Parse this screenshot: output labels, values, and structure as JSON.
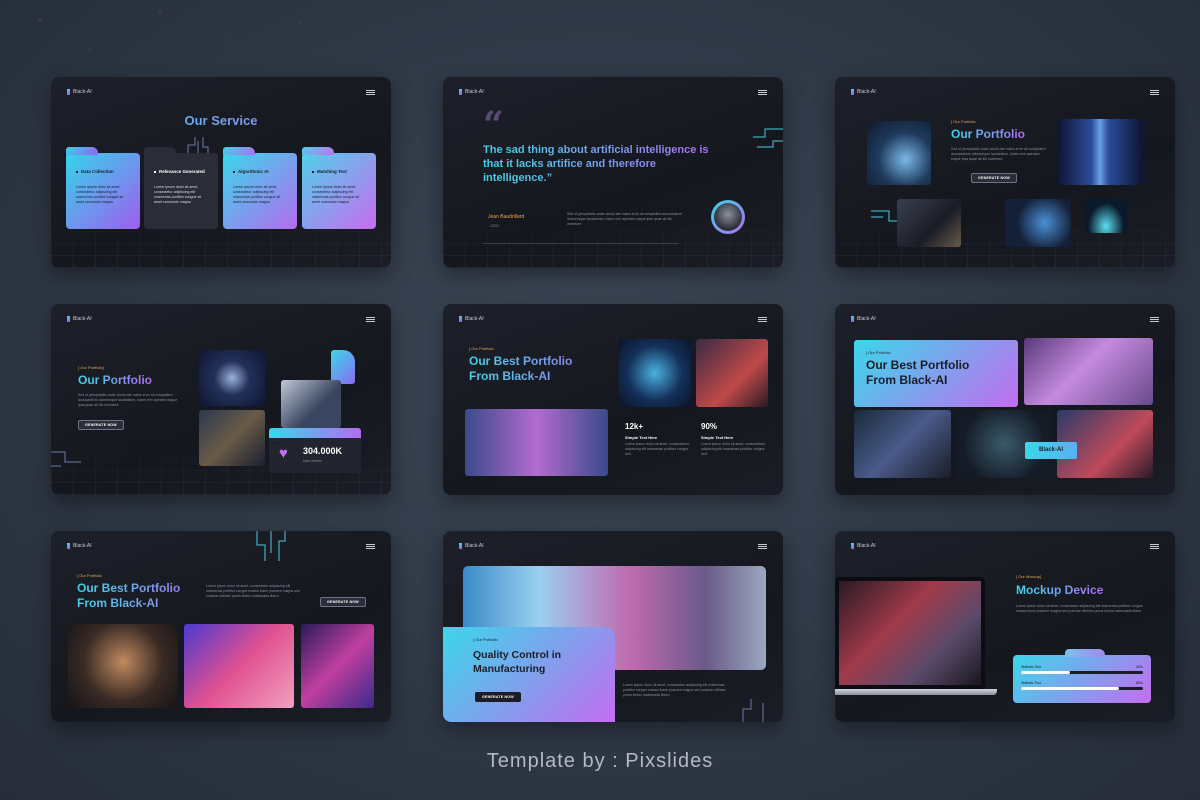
{
  "brand": "Black-AI",
  "footer": "Template by : Pixslides",
  "slide1": {
    "title": "Our Service",
    "cards": [
      {
        "title": "Data Collection",
        "text": "Lorem ipsum dolor sit amet, consectetur adipiscing elit maecenas porttitor congue sit amet commodo magna"
      },
      {
        "title": "Relevance Generated",
        "text": "Lorem ipsum dolor sit amet, consectetur adipiscing elit maecenas porttitor congue sit amet commodo magna"
      },
      {
        "title": "Algorithmic AI",
        "text": "Lorem ipsum dolor sit amet, consectetur adipiscing elit maecenas porttitor congue sit amet commodo magna"
      },
      {
        "title": "Matching Text",
        "text": "Lorem ipsum dolor sit amet, consectetur adipiscing elit maecenas porttitor congue sit amet commodo magna"
      }
    ]
  },
  "slide2": {
    "quote_mark": "“",
    "quote": "The sad thing about artificial intelligence is that it lacks artifice and therefore intelligence.”",
    "author": "Jean Baudrillard",
    "role": "- CEO",
    "text": "Sed ut perspiciatis unde omnis iste natus error sit voluptatem accusantium doloremque laudantium, totam rem aperiam eaque ipsa quae ab illo inventore"
  },
  "slide3": {
    "tag": "[ Our Portfolio",
    "title": "Our Portfolio",
    "text": "Sed ut perspiciatis unde omnis iste natus error sit voluptatem accusantium doloremque laudantium, totam rem aperiam eaque ipsa quae ab illo inventore.",
    "button": "GENERATE NOW"
  },
  "slide4": {
    "tag": "[ Our Portfolio]",
    "title": "Our Portfolio",
    "text": "Sed ut perspiciatis unde omnis iste natus error sit voluptatem accusantium doloremque laudantium, totam rem aperiam eaque ipsa quae ab illo inventore",
    "button": "GENERATE NOW",
    "stat_value": "304.000K",
    "stat_label": "User review"
  },
  "slide5": {
    "tag": "[ Our Portfolio",
    "title_line1": "Our Best Portfolio",
    "title_line2": "From Black-AI",
    "stats": [
      {
        "value": "12k+",
        "label": "Simple Text Here",
        "text": "Lorem ipsum dolor sit amet, consectetuer adipiscing elit maecenas porttitor congue sed"
      },
      {
        "value": "90%",
        "label": "Simple Text Here",
        "text": "Lorem ipsum dolor sit amet, consectetuer adipiscing elit maecenas porttitor congue sed"
      }
    ]
  },
  "slide6": {
    "tag": "[ Our Portfolio",
    "title_line1": "Our Best Portfolio",
    "title_line2": "From Black-AI",
    "badge": "Black-AI"
  },
  "slide7": {
    "tag": "[ Our Portfolio",
    "title_line1": "Our Best Portfolio",
    "title_line2": "From Black-AI",
    "text": "Lorem ipsum dolor sit amet, consectetur adipiscing elit maecenas porttitor congue massa fusce posuere magna sed pulvinar ultricies purus lectus malesuada libero",
    "button": "GENERATE NOW"
  },
  "slide8": {
    "tag": "[ Our Portfolio",
    "title_line1": "Quality Control in",
    "title_line2": "Manufacturing",
    "button": "GENERATE NOW",
    "text": "Lorem ipsum dolor sit amet, consectetur adipiscing elit maecenas porttitor congue massa fusce posuere magna sed pulvinar ultricies purus lectus malesuada libero"
  },
  "slide9": {
    "tag": "[ Our Mockup]",
    "title": "Mockup Device",
    "text": "Lorem ipsum dolor sit amet, consectetur adipiscing elit maecenas porttitor congue massa fusce posuere magna sed pulvinar ultricies purus lectus malesuada libero",
    "bars": [
      {
        "label": "Statistic One",
        "value_label": "40%",
        "value": 0.4
      },
      {
        "label": "Statistic Two",
        "value_label": "80%",
        "value": 0.8
      }
    ]
  }
}
